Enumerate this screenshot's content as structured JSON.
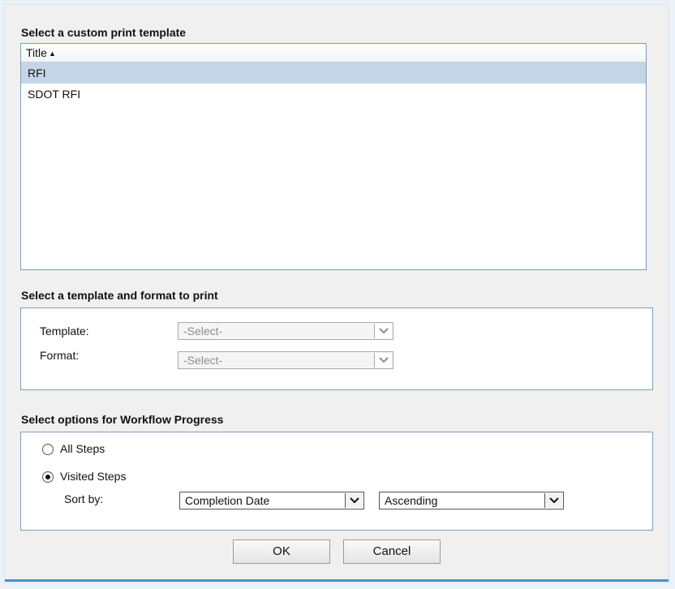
{
  "sections": {
    "template_list_title": "Select a custom print template",
    "template_format_title": "Select a template and format to print",
    "workflow_title": "Select options for Workflow Progress"
  },
  "template_list": {
    "column_header": "Title",
    "sort_icon": "sort-ascending-icon",
    "items": [
      {
        "label": "RFI",
        "selected": true
      },
      {
        "label": "SDOT RFI",
        "selected": false
      }
    ]
  },
  "print_options": {
    "template_label": "Template:",
    "template_value": "-Select-",
    "format_label": "Format:",
    "format_value": "-Select-"
  },
  "workflow": {
    "all_steps_label": "All Steps",
    "visited_steps_label": "Visited Steps",
    "selected_option": "Visited Steps",
    "sort_by_label": "Sort by:",
    "sort_field_value": "Completion Date",
    "sort_order_value": "Ascending"
  },
  "buttons": {
    "ok": "OK",
    "cancel": "Cancel"
  },
  "colors": {
    "selected_row": "#c5d5e8",
    "dialog_border": "#4f8fd0",
    "box_border": "#7f9db9"
  }
}
